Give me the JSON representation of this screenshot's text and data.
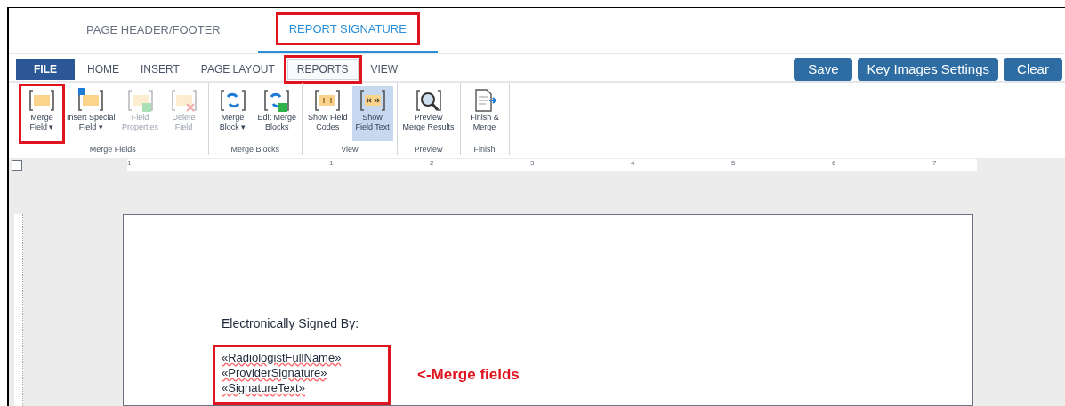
{
  "top_tabs": [
    {
      "label": "PAGE HEADER/FOOTER",
      "selected": false,
      "highlighted": false
    },
    {
      "label": "REPORT SIGNATURE",
      "selected": true,
      "highlighted": true
    }
  ],
  "ribbon_tabs": [
    {
      "label": "FILE",
      "kind": "file",
      "selected": false,
      "highlighted": false
    },
    {
      "label": "HOME",
      "kind": "tab",
      "selected": false,
      "highlighted": false
    },
    {
      "label": "INSERT",
      "kind": "tab",
      "selected": false,
      "highlighted": false
    },
    {
      "label": "PAGE LAYOUT",
      "kind": "tab",
      "selected": false,
      "highlighted": false
    },
    {
      "label": "REPORTS",
      "kind": "tab",
      "selected": true,
      "highlighted": true
    },
    {
      "label": "VIEW",
      "kind": "tab",
      "selected": false,
      "highlighted": false
    }
  ],
  "actions": [
    "Save",
    "Key Images Settings",
    "Clear"
  ],
  "groups": [
    {
      "label": "Merge Fields",
      "buttons": [
        {
          "kind": "field",
          "label": "Merge\nField ▾",
          "disabled": false,
          "selected": false,
          "highlighted": true
        },
        {
          "kind": "special",
          "label": "Insert Special\nField ▾",
          "disabled": false,
          "selected": false,
          "highlighted": false
        },
        {
          "kind": "properties",
          "label": "Field\nProperties",
          "disabled": true,
          "selected": false,
          "highlighted": false
        },
        {
          "kind": "delete",
          "label": "Delete\nField",
          "disabled": true,
          "selected": false,
          "highlighted": false
        }
      ]
    },
    {
      "label": "Merge Blocks",
      "buttons": [
        {
          "kind": "block",
          "label": "Merge\nBlock ▾",
          "disabled": false,
          "selected": false,
          "highlighted": false
        },
        {
          "kind": "editblock",
          "label": "Edit Merge\nBlocks",
          "disabled": false,
          "selected": false,
          "highlighted": false
        }
      ]
    },
    {
      "label": "View",
      "buttons": [
        {
          "kind": "codes",
          "label": "Show Field\nCodes",
          "disabled": false,
          "selected": false,
          "highlighted": false
        },
        {
          "kind": "text",
          "label": "Show\nField Text",
          "disabled": false,
          "selected": true,
          "highlighted": false
        }
      ]
    },
    {
      "label": "Preview",
      "buttons": [
        {
          "kind": "preview",
          "label": "Preview\nMerge Results",
          "disabled": false,
          "selected": false,
          "highlighted": false
        }
      ]
    },
    {
      "label": "Finish",
      "buttons": [
        {
          "kind": "finish",
          "label": "Finish &\nMerge",
          "disabled": false,
          "selected": false,
          "highlighted": false
        }
      ]
    }
  ],
  "ruler": {
    "labels": [
      "1",
      "1",
      "2",
      "3",
      "4",
      "5",
      "6",
      "7"
    ]
  },
  "document": {
    "text": "Electronically Signed By:",
    "merge_fields": [
      "«RadiologistFullName»",
      "«ProviderSignature»",
      "«SignatureText»"
    ],
    "annotation": "<-Merge fields"
  }
}
